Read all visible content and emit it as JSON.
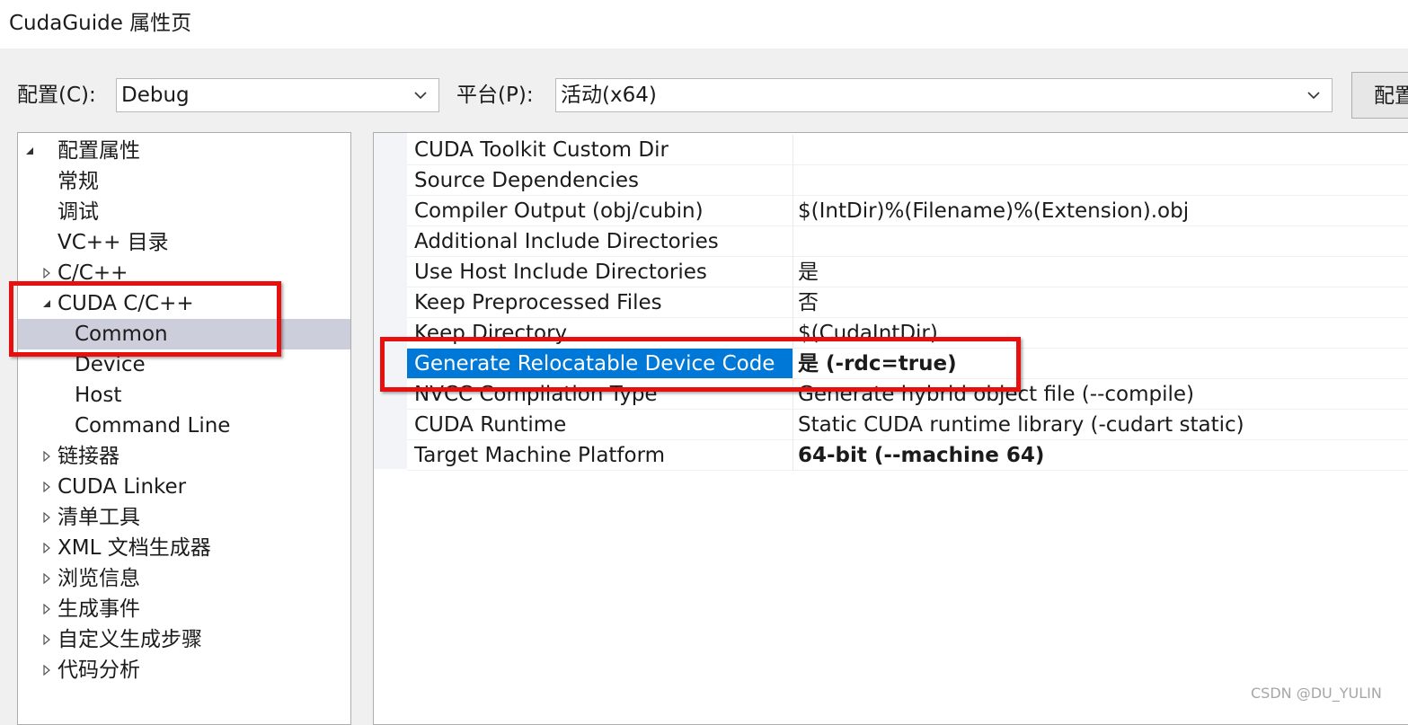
{
  "window": {
    "title": "CudaGuide 属性页"
  },
  "toolbar": {
    "config_label": "配置(C):",
    "config_value": "Debug",
    "platform_label": "平台(P):",
    "platform_value": "活动(x64)",
    "config_manager_label": "配置管理器(O)..."
  },
  "tree": {
    "items": [
      {
        "label": "配置属性",
        "expander": "expanded"
      },
      {
        "label": "常规",
        "expander": "none"
      },
      {
        "label": "调试",
        "expander": "none"
      },
      {
        "label": "VC++ 目录",
        "expander": "none"
      },
      {
        "label": "C/C++",
        "expander": "collapsed"
      },
      {
        "label": "CUDA C/C++",
        "expander": "expanded"
      },
      {
        "label": "Common",
        "expander": "none",
        "selected": true
      },
      {
        "label": "Device",
        "expander": "none"
      },
      {
        "label": "Host",
        "expander": "none"
      },
      {
        "label": "Command Line",
        "expander": "none"
      },
      {
        "label": "链接器",
        "expander": "collapsed"
      },
      {
        "label": "CUDA Linker",
        "expander": "collapsed"
      },
      {
        "label": "清单工具",
        "expander": "collapsed"
      },
      {
        "label": "XML 文档生成器",
        "expander": "collapsed"
      },
      {
        "label": "浏览信息",
        "expander": "collapsed"
      },
      {
        "label": "生成事件",
        "expander": "collapsed"
      },
      {
        "label": "自定义生成步骤",
        "expander": "collapsed"
      },
      {
        "label": "代码分析",
        "expander": "collapsed"
      }
    ]
  },
  "grid": {
    "rows": [
      {
        "name": "CUDA Toolkit Custom Dir",
        "value": ""
      },
      {
        "name": "Source Dependencies",
        "value": ""
      },
      {
        "name": "Compiler Output (obj/cubin)",
        "value": "$(IntDir)%(Filename)%(Extension).obj"
      },
      {
        "name": "Additional Include Directories",
        "value": ""
      },
      {
        "name": "Use Host Include Directories",
        "value": "是"
      },
      {
        "name": "Keep Preprocessed Files",
        "value": "否"
      },
      {
        "name": "Keep Directory",
        "value": "$(CudaIntDir)"
      },
      {
        "name": "Generate Relocatable Device Code",
        "value": "是 (-rdc=true)",
        "selected": true,
        "bold": true
      },
      {
        "name": "NVCC Compilation Type",
        "value": "Generate hybrid object file (--compile)"
      },
      {
        "name": "CUDA Runtime",
        "value": "Static CUDA runtime library (-cudart static)"
      },
      {
        "name": "Target Machine Platform",
        "value": "64-bit (--machine 64)",
        "bold": true
      }
    ]
  },
  "watermark": "CSDN @DU_YULIN",
  "colors": {
    "selection": "#0078d7",
    "tree_selection": "#cccedb",
    "highlight_box": "#e8100f",
    "watermark": "#a6a6a6"
  }
}
